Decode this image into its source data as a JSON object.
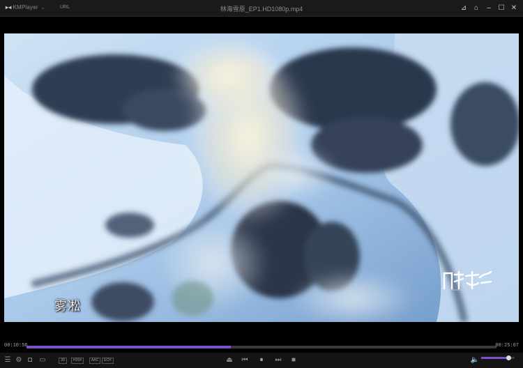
{
  "player": {
    "brand": "KMPlayer",
    "url_label": "URL",
    "file_title": "林海雪原_EP1.HD1080p.mp4"
  },
  "window_buttons": [
    "pin-icon",
    "minimize-to-tray-icon",
    "minimize-icon",
    "maximize-icon",
    "close-icon"
  ],
  "video": {
    "subtitle": "雾凇",
    "watermark": "阿尔泰"
  },
  "playback": {
    "elapsed": "00:10:56",
    "duration": "00:25:07",
    "progress": 0.435
  },
  "tags": [
    "3D",
    "H264",
    "AAC",
    "ECH"
  ],
  "volume": {
    "level": 0.82
  },
  "colors": {
    "accent": "#7b52c9",
    "background": "#000000",
    "chrome": "#1a1a1a"
  }
}
